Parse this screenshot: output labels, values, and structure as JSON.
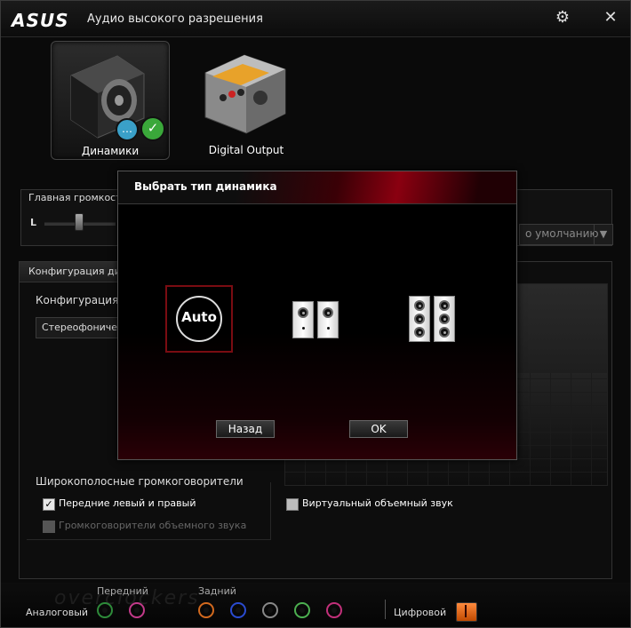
{
  "app": {
    "logo": "ASUS",
    "title": "Аудио высокого разрешения",
    "settings_icon": "gear-icon",
    "close_icon": "close-icon"
  },
  "devices": [
    {
      "label": "Динамики",
      "active": true
    },
    {
      "label": "Digital Output",
      "active": false
    }
  ],
  "volume": {
    "title": "Главная громкость",
    "channel_left": "L",
    "default_label": "о умолчанию"
  },
  "config": {
    "tab_label": "Конфигурация дин",
    "label": "Конфигурация д",
    "selected": "Стереофоничес",
    "wideband_title": "Широкополосные громкоговорители",
    "cb_front": "Передние левый и правый",
    "cb_surround": "Громкоговорители объемного звука",
    "cb_virtual": "Виртуальный объемный звук"
  },
  "bottom": {
    "analog": "Аналоговый",
    "front": "Передний",
    "rear": "Задний",
    "digital": "Цифровой",
    "watermark": "overclockers"
  },
  "colors": {
    "accent_red": "#8a0010",
    "jack_green": "#2e8b3a",
    "jack_pink": "#c23a8a",
    "jack_orange": "#d2691e",
    "jack_blue": "#2a4bd0",
    "jack_gray": "#888888",
    "jack_lime": "#4caf50",
    "jack_magenta": "#c2307a"
  },
  "modal": {
    "title": "Выбрать тип динамика",
    "auto_label": "Auto",
    "back_label": "Назад",
    "ok_label": "OK"
  }
}
